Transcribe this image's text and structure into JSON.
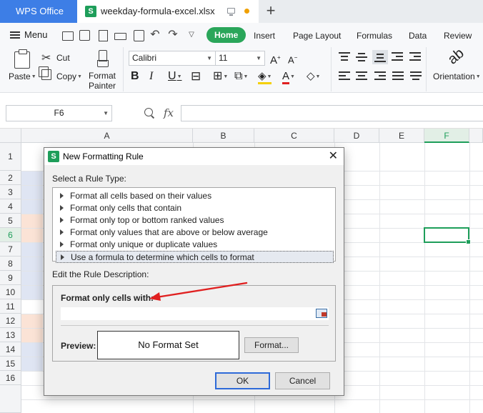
{
  "tabs": {
    "app": "WPS Office",
    "document": "weekday-formula-excel.xlsx",
    "doc_icon_letter": "S",
    "new_tab": "+"
  },
  "menu": {
    "menu_label": "Menu",
    "ribbon_tabs": [
      "Home",
      "Insert",
      "Page Layout",
      "Formulas",
      "Data",
      "Review"
    ],
    "active_tab": "Home",
    "accent": "#2aa65a"
  },
  "ribbon": {
    "paste": "Paste",
    "cut": "Cut",
    "copy": "Copy",
    "format_painter_line1": "Format",
    "format_painter_line2": "Painter",
    "font_name": "Calibri",
    "font_size": "11",
    "bold": "B",
    "italic": "I",
    "underline": "U",
    "orientation": "Orientation"
  },
  "formula_bar": {
    "name_box": "F6",
    "fx": "fx",
    "formula": ""
  },
  "grid": {
    "columns": [
      "A",
      "B",
      "C",
      "D",
      "E",
      "F"
    ],
    "selected_column": "F",
    "rows": [
      "1",
      "2",
      "3",
      "4",
      "5",
      "6",
      "7",
      "8",
      "9",
      "10",
      "11",
      "12",
      "13",
      "14",
      "15",
      "16"
    ],
    "selected_row": "6",
    "active_cell": "F6",
    "fill_colors": {
      "blue": "#dfe5f3",
      "peach": "#fbe3d6"
    }
  },
  "dialog": {
    "icon_letter": "S",
    "title": "New Formatting Rule",
    "close": "✕",
    "select_rule_type_label": "Select a Rule Type:",
    "rule_types": [
      "Format all cells based on their values",
      "Format only cells that contain",
      "Format only top or bottom ranked values",
      "Format only values that are above or below average",
      "Format only unique or duplicate values",
      "Use a formula to determine which cells to format"
    ],
    "selected_rule_index": 5,
    "edit_description_label": "Edit the Rule Description:",
    "format_only_cells_with": "Format only cells with:",
    "formula_value": "",
    "preview_label": "Preview:",
    "preview_text": "No Format Set",
    "format_button": "Format...",
    "ok_button": "OK",
    "cancel_button": "Cancel"
  },
  "annotation": {
    "arrow_color": "#e02020"
  }
}
